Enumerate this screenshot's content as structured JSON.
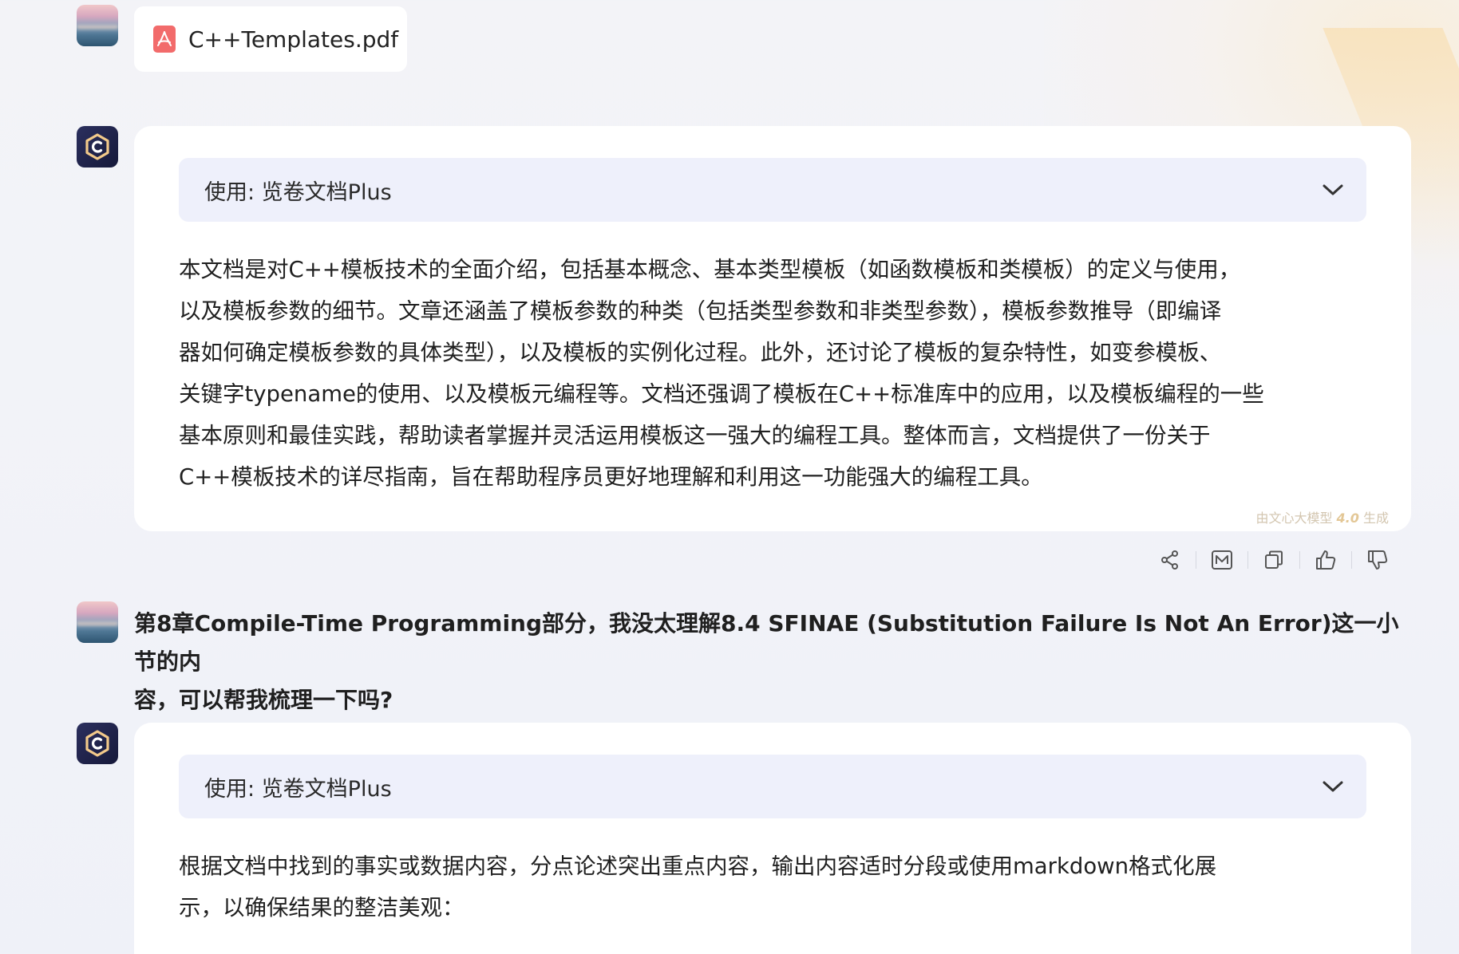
{
  "file": {
    "name": "C++Templates.pdf",
    "icon": "pdf-icon"
  },
  "reply1": {
    "tool_label": "使用: 览卷文档Plus",
    "answer_lines": [
      "本文档是对C++模板技术的全面介绍，包括基本概念、基本类型模板（如函数模板和类模板）的定义与使用，",
      "以及模板参数的细节。文章还涵盖了模板参数的种类（包括类型参数和非类型参数），模板参数推导（即编译",
      "器如何确定模板参数的具体类型），以及模板的实例化过程。此外，还讨论了模板的复杂特性，如变参模板、",
      "关键字typename的使用、以及模板元编程等。文档还强调了模板在C++标准库中的应用，以及模板编程的一些",
      "基本原则和最佳实践，帮助读者掌握并灵活运用模板这一强大的编程工具。整体而言，文档提供了一份关于",
      "C++模板技术的详尽指南，旨在帮助程序员更好地理解和利用这一功能强大的编程工具。"
    ],
    "gen_prefix": "由文心大模型",
    "gen_version": "4.0",
    "gen_suffix": "生成"
  },
  "actions": {
    "icons": [
      "share-icon",
      "mindmap-icon",
      "copy-icon",
      "thumbs-up-icon",
      "thumbs-down-icon"
    ]
  },
  "question": {
    "lines": [
      "第8章Compile-Time Programming部分，我没太理解8.4 SFINAE (Substitution Failure Is Not An Error)这一小节的内",
      "容，可以帮我梳理一下吗?"
    ]
  },
  "reply2": {
    "tool_label": "使用: 览卷文档Plus",
    "answer_lines": [
      "根据文档中找到的事实或数据内容，分点论述突出重点内容，输出内容适时分段或使用markdown格式化展",
      "示，以确保结果的整洁美观："
    ]
  },
  "colors": {
    "page_bg": "#f3f3f7",
    "card_bg": "#ffffff",
    "tool_bar_bg": "#eef0fb",
    "pdf_red": "#f26b6b",
    "bot_avatar": "#1e2148",
    "gen_badge": "#d3c6b0"
  }
}
